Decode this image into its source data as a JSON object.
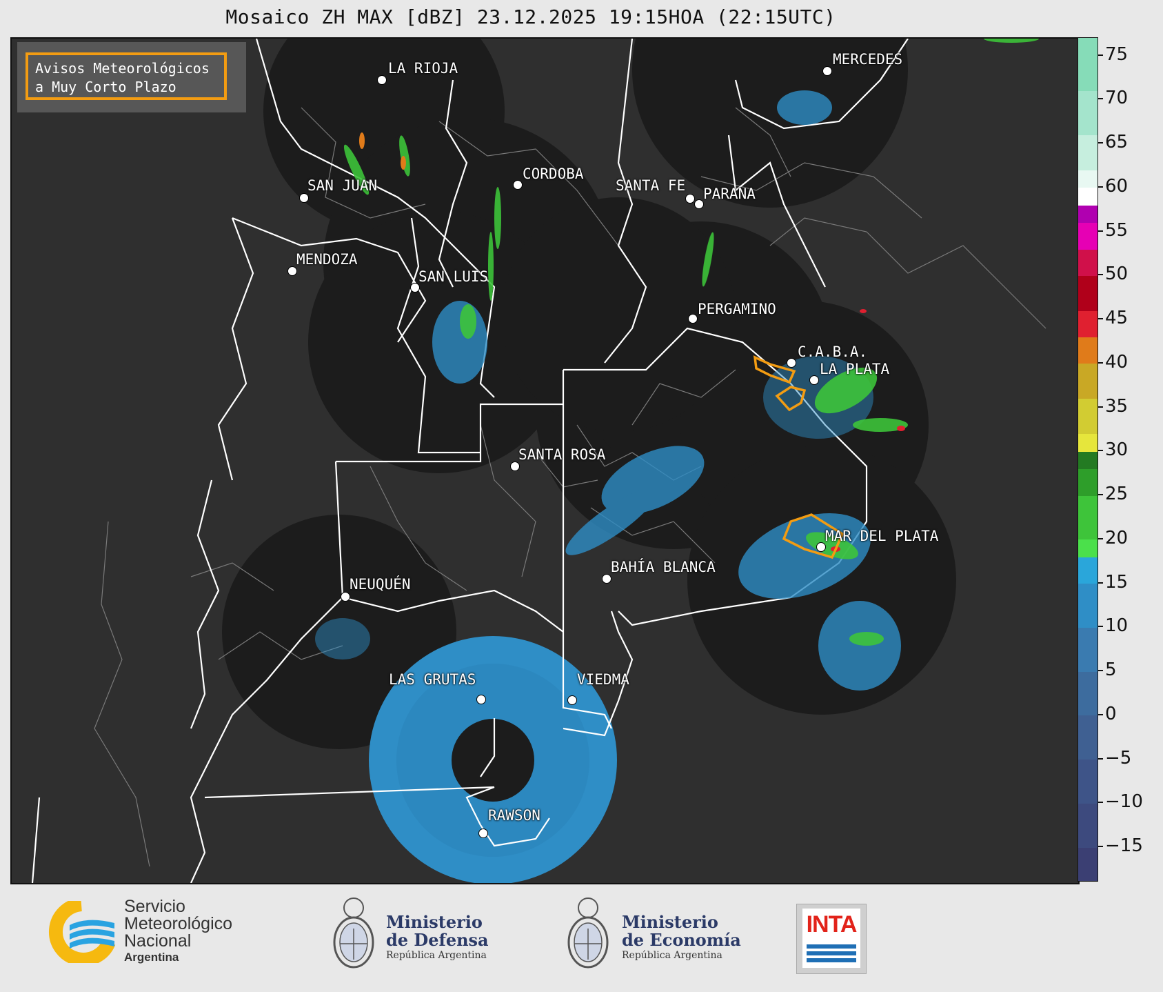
{
  "title": "Mosaico ZH MAX [dBZ] 23.12.2025 19:15HOA (22:15UTC)",
  "aviso_box": {
    "line1": "Avisos Meteorológicos",
    "line2": "a Muy Corto Plazo",
    "border_color": "#f39c12"
  },
  "cities": [
    {
      "name": "LA RIOJA"
    },
    {
      "name": "MERCEDES"
    },
    {
      "name": "SAN JUAN"
    },
    {
      "name": "CORDOBA"
    },
    {
      "name": "SANTA FE"
    },
    {
      "name": "PARANA"
    },
    {
      "name": "MENDOZA"
    },
    {
      "name": "SAN LUIS"
    },
    {
      "name": "PERGAMINO"
    },
    {
      "name": "C.A.B.A."
    },
    {
      "name": "LA PLATA"
    },
    {
      "name": "SANTA ROSA"
    },
    {
      "name": "MAR DEL PLATA"
    },
    {
      "name": "BAHÍA BLANCA"
    },
    {
      "name": "NEUQUÉN"
    },
    {
      "name": "LAS GRUTAS"
    },
    {
      "name": "VIEDMA"
    },
    {
      "name": "RAWSON"
    }
  ],
  "colorbar": {
    "label_unit": "dBZ",
    "range": [
      -19,
      77
    ],
    "ticks": [
      "75",
      "70",
      "65",
      "60",
      "55",
      "50",
      "45",
      "40",
      "35",
      "30",
      "25",
      "20",
      "15",
      "10",
      "5",
      "0",
      "−5",
      "−10",
      "−15"
    ],
    "tick_values": [
      75,
      70,
      65,
      60,
      55,
      50,
      45,
      40,
      35,
      30,
      25,
      20,
      15,
      10,
      5,
      0,
      -5,
      -10,
      -15
    ],
    "segments": [
      {
        "from": -19,
        "to": -15,
        "color": "#3b3f73"
      },
      {
        "from": -15,
        "to": -10,
        "color": "#3d4a7e"
      },
      {
        "from": -10,
        "to": -5,
        "color": "#3e5488"
      },
      {
        "from": -5,
        "to": 0,
        "color": "#3f6092"
      },
      {
        "from": 0,
        "to": 5,
        "color": "#3d6c9e"
      },
      {
        "from": 5,
        "to": 10,
        "color": "#3a7bb0"
      },
      {
        "from": 10,
        "to": 15,
        "color": "#2f8ec6"
      },
      {
        "from": 15,
        "to": 18,
        "color": "#2aa6da"
      },
      {
        "from": 18,
        "to": 20,
        "color": "#4be04b"
      },
      {
        "from": 20,
        "to": 25,
        "color": "#3ec43a"
      },
      {
        "from": 25,
        "to": 28,
        "color": "#2e9e2a"
      },
      {
        "from": 28,
        "to": 30,
        "color": "#237a22"
      },
      {
        "from": 30,
        "to": 32,
        "color": "#e6e63c"
      },
      {
        "from": 32,
        "to": 36,
        "color": "#d2cc32"
      },
      {
        "from": 36,
        "to": 40,
        "color": "#c9a825"
      },
      {
        "from": 40,
        "to": 43,
        "color": "#e07b1a"
      },
      {
        "from": 43,
        "to": 46,
        "color": "#e02030"
      },
      {
        "from": 46,
        "to": 50,
        "color": "#b0001a"
      },
      {
        "from": 50,
        "to": 53,
        "color": "#d0104a"
      },
      {
        "from": 53,
        "to": 56,
        "color": "#e600b4"
      },
      {
        "from": 56,
        "to": 58,
        "color": "#b000b0"
      },
      {
        "from": 58,
        "to": 60,
        "color": "#ffffff"
      },
      {
        "from": 60,
        "to": 62,
        "color": "#e8f8f2"
      },
      {
        "from": 62,
        "to": 66,
        "color": "#c6eede"
      },
      {
        "from": 66,
        "to": 71,
        "color": "#a4e4cc"
      },
      {
        "from": 71,
        "to": 77,
        "color": "#86dcb8"
      }
    ]
  },
  "footer": {
    "smn": {
      "line1": "Servicio",
      "line2": "Meteorológico",
      "line3": "Nacional",
      "line4": "Argentina"
    },
    "defensa": {
      "line1": "Ministerio",
      "line2": "de Defensa",
      "line3": "República Argentina"
    },
    "economia": {
      "line1": "Ministerio",
      "line2": "de Economía",
      "line3": "República Argentina"
    },
    "inta": {
      "text": "INTA"
    }
  },
  "colors": {
    "map_background": "#2f2f2f",
    "radar_coverage": "#1c1c1c",
    "province_borders": "#ffffff",
    "department_borders": "#7a7a7a",
    "weak_echo": "#2f8ec6",
    "moderate_echo": "#3ec43a",
    "warning_polygon": "#f39c12"
  }
}
